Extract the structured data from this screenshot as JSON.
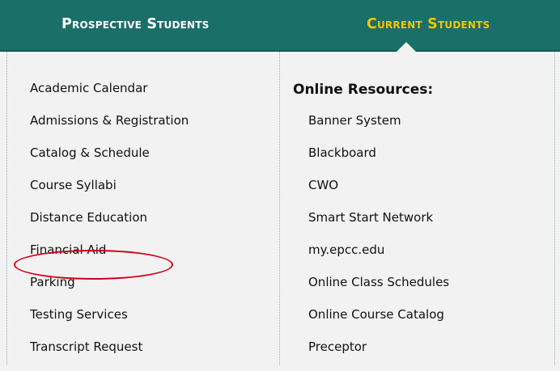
{
  "nav": {
    "prospective_label": "Prospective Students",
    "current_label": "Current Students"
  },
  "left_column": {
    "items": [
      "Academic Calendar",
      "Admissions & Registration",
      "Catalog & Schedule",
      "Course Syllabi",
      "Distance Education",
      "Financial Aid",
      "Parking",
      "Testing Services",
      "Transcript Request"
    ]
  },
  "right_column": {
    "heading": "Online Resources:",
    "items": [
      "Banner System",
      "Blackboard",
      "CWO",
      "Smart Start Network",
      "my.epcc.edu",
      "Online Class Schedules",
      "Online Course Catalog",
      "Preceptor"
    ]
  },
  "colors": {
    "nav_background": "#1a6f68",
    "active_tab": "#f5c400",
    "inactive_tab": "#ffffff",
    "annotation": "#d0021b"
  }
}
